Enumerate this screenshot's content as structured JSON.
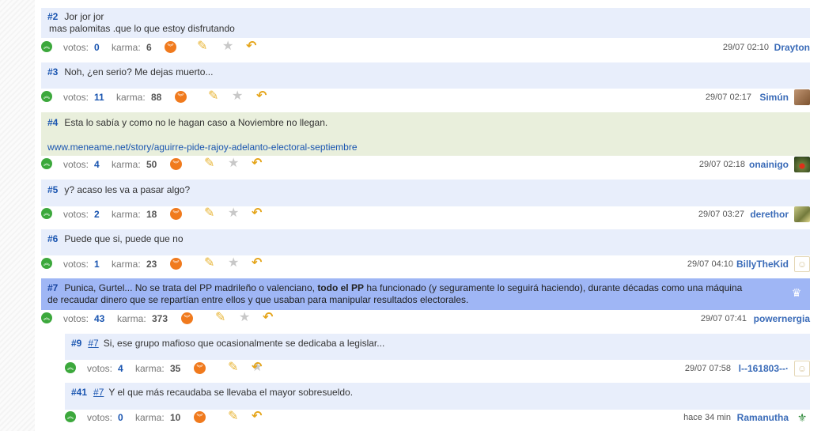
{
  "comments": [
    {
      "num": "#2",
      "lines": [
        "Jor jor jor",
        "mas palomitas .que lo que estoy disfrutando"
      ],
      "votes_label": "votos:",
      "votes": "0",
      "karma_label": "karma:",
      "karma": "6",
      "time": "29/07 02:10",
      "user": "Drayton"
    },
    {
      "num": "#3",
      "text": "Noh, ¿en serio? Me dejas muerto...",
      "votes_label": "votos:",
      "votes": "11",
      "karma_label": "karma:",
      "karma": "88",
      "time": "29/07 02:17",
      "user": "Simún"
    },
    {
      "num": "#4",
      "text": "Esta lo sabía y como no le hagan caso a Noviembre no llegan.",
      "link": "www.meneame.net/story/aguirre-pide-rajoy-adelanto-electoral-septiembre",
      "votes_label": "votos:",
      "votes": "4",
      "karma_label": "karma:",
      "karma": "50",
      "time": "29/07 02:18",
      "user": "onainigo"
    },
    {
      "num": "#5",
      "text": "y? acaso les va a pasar algo?",
      "votes_label": "votos:",
      "votes": "2",
      "karma_label": "karma:",
      "karma": "18",
      "time": "29/07 03:27",
      "user": "derethor"
    },
    {
      "num": "#6",
      "text": "Puede que si, puede que no",
      "votes_label": "votos:",
      "votes": "1",
      "karma_label": "karma:",
      "karma": "23",
      "time": "29/07 04:10",
      "user": "BillyTheKid"
    },
    {
      "num": "#7",
      "text_a": "Punica, Gurtel... No se trata del PP madrileño o valenciano, ",
      "text_bold": "todo el PP",
      "text_b": " ha funcionado (y seguramente lo seguirá haciendo), durante décadas como una máquina",
      "line2": "de recaudar dinero que se repartían entre ellos y que usaban para manipular resultados electorales.",
      "votes_label": "votos:",
      "votes": "43",
      "karma_label": "karma:",
      "karma": "373",
      "time": "29/07 07:41",
      "user": "powernergia"
    },
    {
      "num": "#9",
      "ref": "#7",
      "text": "Si, ese grupo mafioso que ocasionalmente se dedicaba a legislar...",
      "votes_label": "votos:",
      "votes": "4",
      "karma_label": "karma:",
      "karma": "35",
      "time": "29/07 07:58",
      "user": "l--161803--·"
    },
    {
      "num": "#41",
      "ref": "#7",
      "text": "Y el que más recaudaba se llevaba el mayor sobresueldo.",
      "votes_label": "votos:",
      "votes": "0",
      "karma_label": "karma:",
      "karma": "10",
      "time": "hace 34 min",
      "user": "Ramanutha"
    }
  ],
  "icons": {
    "vote_up": "chevron-double-up-icon",
    "vote_down": "chevron-double-down-icon",
    "feather": "feather-icon",
    "star": "star-icon",
    "reply": "reply-arrow-icon"
  },
  "colors": {
    "comment_bg": "#e8eefb",
    "highlight_bg": "#9fb6f5",
    "link_bg": "#e9efdc",
    "vote_up": "#3ca83c",
    "vote_down": "#f07a1d",
    "link": "#1a55b0"
  }
}
